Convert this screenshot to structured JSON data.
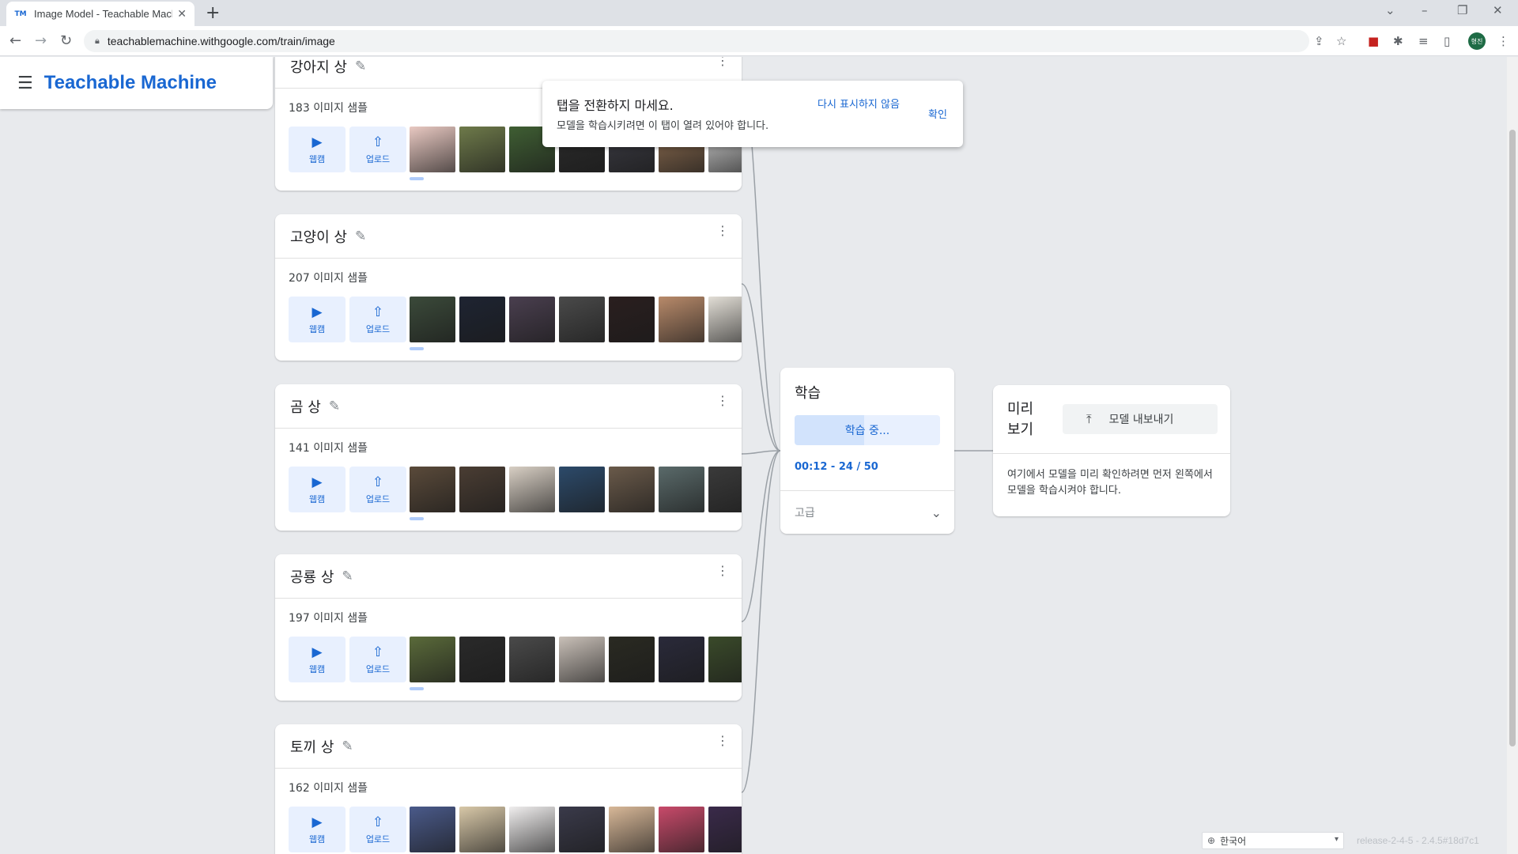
{
  "browser": {
    "tab_title": "Image Model - Teachable Mach",
    "tab_favicon": "TM",
    "url": "teachablemachine.withgoogle.com/train/image",
    "avatar_label": "형진"
  },
  "app": {
    "brand": "Teachable Machine"
  },
  "toast": {
    "title": "탭을 전환하지 마세요.",
    "message": "모델을 학습시키려면 이 탭이 열려 있어야 합니다.",
    "dont_show_label": "다시 표시하지 않음",
    "ok_label": "확인"
  },
  "classes": [
    {
      "name": "강아지 상",
      "sample_count": "183",
      "thumb_colors": [
        "#e9c9c2",
        "#6e7a4a",
        "#3f5e33",
        "#2b2b2b",
        "#3a3a42",
        "#8a6a4e",
        "#c9c9c9"
      ]
    },
    {
      "name": "고양이 상",
      "sample_count": "207",
      "thumb_colors": [
        "#3b4a3a",
        "#1e2432",
        "#4a3f4f",
        "#4a4a4a",
        "#2a1f1f",
        "#b88a6a",
        "#e2ded6"
      ]
    },
    {
      "name": "곰 상",
      "sample_count": "141",
      "thumb_colors": [
        "#5a4a3a",
        "#4a3d33",
        "#d8cfc4",
        "#2c4a6a",
        "#6a5a4a",
        "#5a6a6a",
        "#3a3a3a"
      ]
    },
    {
      "name": "공룡 상",
      "sample_count": "197",
      "thumb_colors": [
        "#5a6a3a",
        "#2a2a2a",
        "#4a4a4a",
        "#c9c0b8",
        "#2a2a22",
        "#2a2a3a",
        "#3a4a2a"
      ]
    },
    {
      "name": "토끼 상",
      "sample_count": "162",
      "thumb_colors": [
        "#4a5a8a",
        "#d8c8a8",
        "#f0eeee",
        "#3a3a4a",
        "#d8b898",
        "#c84a6a",
        "#3a2a4a"
      ]
    }
  ],
  "labels": {
    "sample_suffix": "이미지 샘플",
    "webcam": "웹캠",
    "upload": "업로드"
  },
  "training": {
    "title": "학습",
    "status_label": "학습 중...",
    "progress_fraction": 0.48,
    "time_text": "00:12 - 24 / 50",
    "advanced_label": "고급"
  },
  "preview": {
    "title": "미리 보기",
    "export_label": "모델 내보내기",
    "message": "여기에서 모델을 미리 확인하려면 먼저 왼쪽에서 모델을 학습시켜야 합니다."
  },
  "footer": {
    "language": "한국어",
    "release": "release-2-4-5 - 2.4.5#18d7c1"
  },
  "colors": {
    "accent": "#1967d2",
    "button_bg": "#e8f0fe",
    "page_bg": "#e8eaed"
  }
}
